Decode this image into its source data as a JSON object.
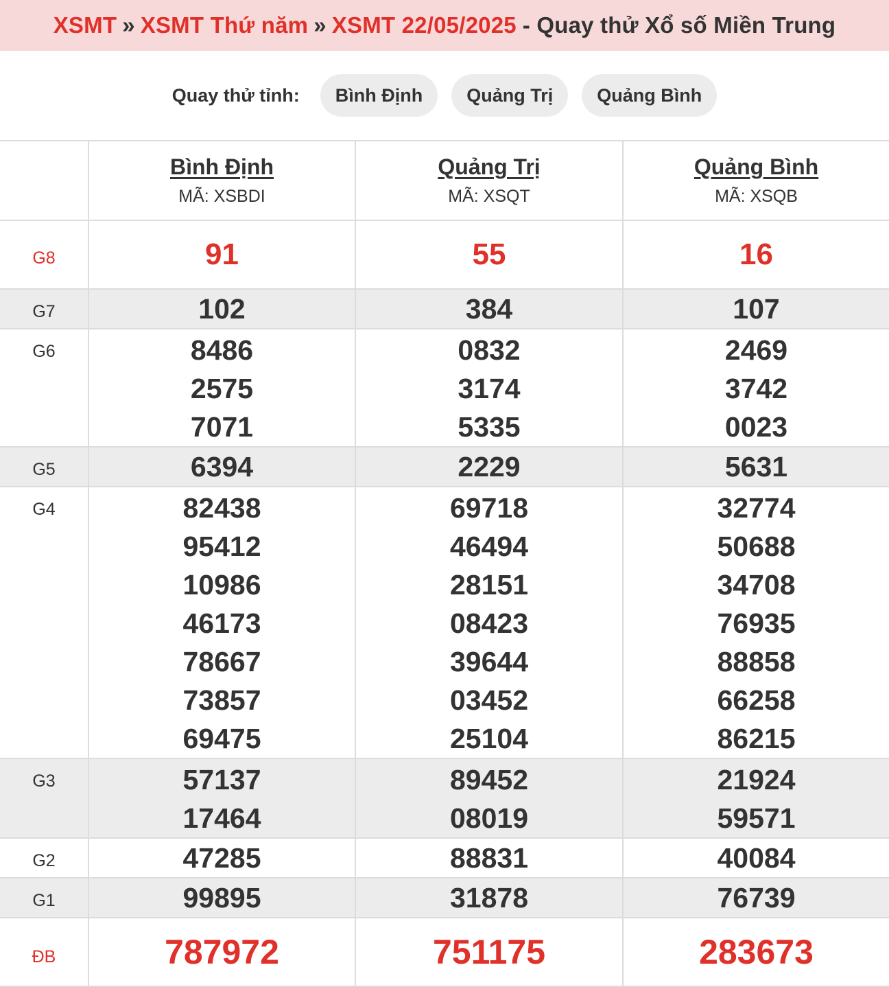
{
  "breadcrumb": {
    "item1": "XSMT",
    "item2": "XSMT Thứ năm",
    "item3": "XSMT 22/05/2025",
    "separator": "»",
    "suffix": "- Quay thử Xổ số Miền Trung"
  },
  "picker": {
    "label": "Quay thử tỉnh:",
    "options": [
      "Bình Định",
      "Quảng Trị",
      "Quảng Bình"
    ]
  },
  "provinces": [
    {
      "name": "Bình Định",
      "code": "MÃ: XSBDI"
    },
    {
      "name": "Quảng Trị",
      "code": "MÃ: XSQT"
    },
    {
      "name": "Quảng Bình",
      "code": "MÃ: XSQB"
    }
  ],
  "prizes": [
    {
      "label": "G8",
      "values": [
        [
          "91"
        ],
        [
          "55"
        ],
        [
          "16"
        ]
      ]
    },
    {
      "label": "G7",
      "values": [
        [
          "102"
        ],
        [
          "384"
        ],
        [
          "107"
        ]
      ]
    },
    {
      "label": "G6",
      "values": [
        [
          "8486",
          "2575",
          "7071"
        ],
        [
          "0832",
          "3174",
          "5335"
        ],
        [
          "2469",
          "3742",
          "0023"
        ]
      ]
    },
    {
      "label": "G5",
      "values": [
        [
          "6394"
        ],
        [
          "2229"
        ],
        [
          "5631"
        ]
      ]
    },
    {
      "label": "G4",
      "values": [
        [
          "82438",
          "95412",
          "10986",
          "46173",
          "78667",
          "73857",
          "69475"
        ],
        [
          "69718",
          "46494",
          "28151",
          "08423",
          "39644",
          "03452",
          "25104"
        ],
        [
          "32774",
          "50688",
          "34708",
          "76935",
          "88858",
          "66258",
          "86215"
        ]
      ]
    },
    {
      "label": "G3",
      "values": [
        [
          "57137",
          "17464"
        ],
        [
          "89452",
          "08019"
        ],
        [
          "21924",
          "59571"
        ]
      ]
    },
    {
      "label": "G2",
      "values": [
        [
          "47285"
        ],
        [
          "88831"
        ],
        [
          "40084"
        ]
      ]
    },
    {
      "label": "G1",
      "values": [
        [
          "99895"
        ],
        [
          "31878"
        ],
        [
          "76739"
        ]
      ]
    },
    {
      "label": "ĐB",
      "values": [
        [
          "787972"
        ],
        [
          "751175"
        ],
        [
          "283673"
        ]
      ]
    }
  ],
  "colors": {
    "accent": "#e0302a",
    "header_bg": "#f7d9d9",
    "shade": "#ececec",
    "pill": "#ececec"
  }
}
